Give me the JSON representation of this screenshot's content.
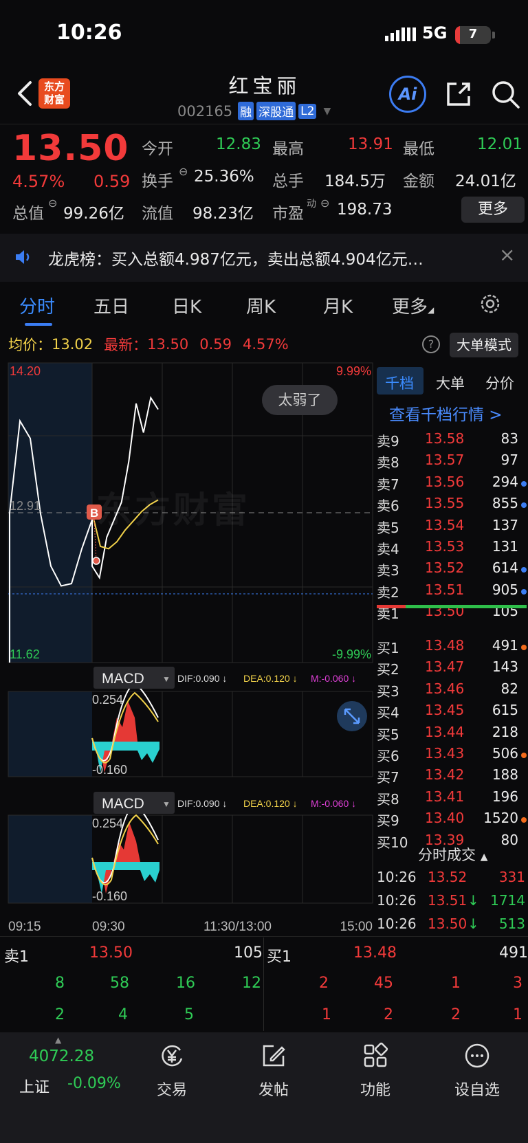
{
  "status_bar": {
    "time": "10:26",
    "network": "5G",
    "battery": "7"
  },
  "header": {
    "logo": "东方\n财富",
    "name": "红宝丽",
    "code": "002165",
    "tags": [
      "融",
      "深股通",
      "L2"
    ],
    "ai": "Ai"
  },
  "quote": {
    "price": "13.50",
    "pct": "4.57%",
    "chg": "0.59",
    "open_label": "今开",
    "open": "12.83",
    "high_label": "最高",
    "high": "13.91",
    "low_label": "最低",
    "low": "12.01",
    "turnover_label": "换手",
    "turnover": "25.36%",
    "volume_label": "总手",
    "volume": "184.5万",
    "amount_label": "金额",
    "amount": "24.01亿",
    "mktcap_label": "总值",
    "mktcap": "99.26亿",
    "float_label": "流值",
    "float": "98.23亿",
    "pe_label": "市盈",
    "pe_sup": "动",
    "pe": "198.73",
    "more": "更多"
  },
  "notice": {
    "text": "龙虎榜：买入总额4.987亿元，卖出总额4.904亿元…"
  },
  "tabs": [
    "分时",
    "五日",
    "日K",
    "周K",
    "月K",
    "更多"
  ],
  "info": {
    "avg_label": "均价：",
    "avg": "13.02",
    "last_label": "最新：",
    "last": "13.50",
    "chg": "0.59",
    "pct": "4.57%",
    "big_order": "大单模式"
  },
  "chart": {
    "y_top": "14.20",
    "y_mid": "12.91",
    "y_bot": "11.62",
    "pct_top": "9.99%",
    "pct_bot": "-9.99%",
    "bubble": "太弱了",
    "watermark": "东方财富",
    "b_marker": "B",
    "x_labels": [
      "09:15",
      "09:30",
      "11:30/13:00",
      "15:00"
    ]
  },
  "chart_data": {
    "type": "line",
    "title": "",
    "ylim": [
      11.62,
      14.2
    ],
    "series": [
      {
        "name": "",
        "color": "#ffffff",
        "values": [
          12.91,
          13.7,
          13.55,
          12.9,
          12.45,
          12.28,
          12.3,
          12.6,
          12.85,
          12.45,
          12.35,
          12.7,
          12.85,
          13.0,
          13.35,
          13.85,
          13.6,
          13.9,
          13.8
        ]
      },
      {
        "name": "",
        "color": "#f2d24a",
        "values": [
          12.91,
          12.62,
          12.6,
          12.66,
          12.76,
          12.84,
          12.92,
          12.98,
          13.02
        ]
      }
    ],
    "x": [
      "09:15",
      "09:30",
      "11:30/13:00",
      "15:00"
    ]
  },
  "macd": {
    "label": "MACD",
    "dif": "DIF:0.090 ↓",
    "dea": "DEA:0.120 ↓",
    "m": "M:-0.060 ↓",
    "hi": "0.254",
    "lo": "-0.160"
  },
  "orderbook": {
    "tabs": [
      "千档",
      "大单",
      "分价"
    ],
    "link": "查看千档行情 >",
    "asks": [
      {
        "label": "卖9",
        "price": "13.58",
        "vol": "83",
        "dot": ""
      },
      {
        "label": "卖8",
        "price": "13.57",
        "vol": "97",
        "dot": ""
      },
      {
        "label": "卖7",
        "price": "13.56",
        "vol": "294",
        "dot": "#3b7df3"
      },
      {
        "label": "卖6",
        "price": "13.55",
        "vol": "855",
        "dot": "#3b7df3"
      },
      {
        "label": "卖5",
        "price": "13.54",
        "vol": "137",
        "dot": ""
      },
      {
        "label": "卖4",
        "price": "13.53",
        "vol": "131",
        "dot": ""
      },
      {
        "label": "卖3",
        "price": "13.52",
        "vol": "614",
        "dot": "#3b7df3"
      },
      {
        "label": "卖2",
        "price": "13.51",
        "vol": "905",
        "dot": "#3b7df3"
      },
      {
        "label": "卖1",
        "price": "13.50",
        "vol": "105",
        "dot": ""
      }
    ],
    "bids": [
      {
        "label": "买1",
        "price": "13.48",
        "vol": "491",
        "dot": "#f26a1b"
      },
      {
        "label": "买2",
        "price": "13.47",
        "vol": "143",
        "dot": ""
      },
      {
        "label": "买3",
        "price": "13.46",
        "vol": "82",
        "dot": ""
      },
      {
        "label": "买4",
        "price": "13.45",
        "vol": "615",
        "dot": ""
      },
      {
        "label": "买5",
        "price": "13.44",
        "vol": "218",
        "dot": ""
      },
      {
        "label": "买6",
        "price": "13.43",
        "vol": "506",
        "dot": "#f26a1b"
      },
      {
        "label": "买7",
        "price": "13.42",
        "vol": "188",
        "dot": ""
      },
      {
        "label": "买8",
        "price": "13.41",
        "vol": "196",
        "dot": ""
      },
      {
        "label": "买9",
        "price": "13.40",
        "vol": "1520",
        "dot": "#f26a1b"
      },
      {
        "label": "买10",
        "price": "13.39",
        "vol": "80",
        "dot": ""
      }
    ],
    "ticks_title": "分时成交",
    "ticks": [
      {
        "time": "10:26",
        "price": "13.52",
        "arrow": "",
        "vol": "331",
        "vcolor": "#f23a3a"
      },
      {
        "time": "10:26",
        "price": "13.51",
        "arrow": "↓",
        "vol": "1714",
        "vcolor": "#2fcc56"
      },
      {
        "time": "10:26",
        "price": "13.50",
        "arrow": "↓",
        "vol": "513",
        "vcolor": "#2fcc56"
      }
    ]
  },
  "summary": {
    "sell_label": "卖1",
    "sell_price": "13.50",
    "sell_vol": "105",
    "buy_label": "买1",
    "buy_price": "13.48",
    "buy_vol": "491",
    "sell_row1": [
      "8",
      "58",
      "16",
      "12"
    ],
    "sell_row2": [
      "2",
      "4",
      "5"
    ],
    "buy_row1": [
      "2",
      "45",
      "1",
      "3"
    ],
    "buy_row2": [
      "1",
      "2",
      "2",
      "1"
    ]
  },
  "nav": {
    "index_value": "4072.28",
    "index_name": "上证",
    "index_chg": "-0.09%",
    "items": [
      "交易",
      "发帖",
      "功能",
      "设自选"
    ]
  }
}
